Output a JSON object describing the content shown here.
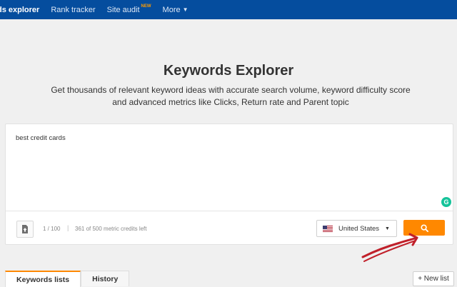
{
  "nav": {
    "items": [
      {
        "label": "ds explorer"
      },
      {
        "label": "Rank tracker"
      },
      {
        "label": "Site audit",
        "badge": "NEW"
      },
      {
        "label": "More"
      }
    ]
  },
  "header": {
    "title": "Keywords Explorer",
    "subtitle_line1": "Get thousands of relevant keyword ideas with accurate search volume, keyword difficulty score",
    "subtitle_line2": "and advanced metrics like Clicks, Return rate and Parent topic"
  },
  "search": {
    "query": "best credit cards",
    "count": "1 / 100",
    "separator": "|",
    "credits": "361 of 500 metric credits left",
    "country": "United States"
  },
  "tabs": [
    {
      "label": "Keywords lists"
    },
    {
      "label": "History"
    }
  ],
  "new_list_label": "+ New list",
  "colors": {
    "nav_bg": "#054d9e",
    "accent": "#ff8800",
    "annotation": "#c0202a"
  }
}
